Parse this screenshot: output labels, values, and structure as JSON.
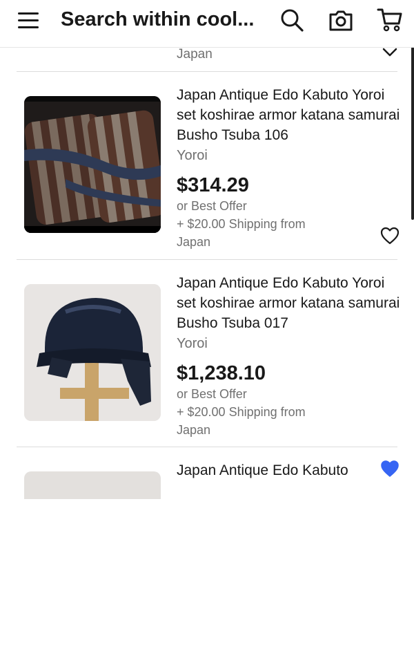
{
  "header": {
    "search_text": "Search within cool...",
    "icons": [
      "menu-icon",
      "search-icon",
      "camera-icon",
      "cart-icon"
    ]
  },
  "partial_item": {
    "location": "Japan",
    "icon": "chevron-down-icon"
  },
  "items": [
    {
      "title": "Japan Antique Edo Kabuto Yoroi set koshirae armor katana samurai Busho Tsuba 106",
      "subtitle": "Yoroi",
      "price": "$314.29",
      "offer": "or Best Offer",
      "shipping": "+ $20.00 Shipping from",
      "location": "Japan",
      "watched": false
    },
    {
      "title": "Japan Antique Edo Kabuto Yoroi set koshirae armor katana samurai Busho Tsuba 017",
      "subtitle": "Yoroi",
      "price": "$1,238.10",
      "offer": "or Best Offer",
      "shipping": "+ $20.00 Shipping from",
      "location": "Japan",
      "watched": true
    },
    {
      "title": "Japan Antique Edo Kabuto"
    }
  ],
  "colors": {
    "text": "#191919",
    "secondary": "#707070",
    "watch_active": "#3665f3"
  }
}
